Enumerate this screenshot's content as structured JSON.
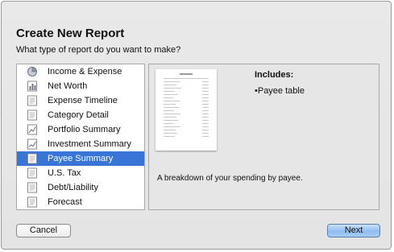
{
  "dialog": {
    "title": "Create New Report",
    "subtitle": "What type of report do you want to make?"
  },
  "report_types": [
    {
      "label": "Income & Expense",
      "icon": "pie-chart-icon"
    },
    {
      "label": "Net Worth",
      "icon": "bar-chart-icon"
    },
    {
      "label": "Expense Timeline",
      "icon": "report-page-icon"
    },
    {
      "label": "Category Detail",
      "icon": "report-page-icon"
    },
    {
      "label": "Portfolio Summary",
      "icon": "line-chart-icon"
    },
    {
      "label": "Investment Summary",
      "icon": "line-chart-icon"
    },
    {
      "label": "Payee Summary",
      "icon": "report-page-icon",
      "selected": true
    },
    {
      "label": "U.S. Tax",
      "icon": "report-page-icon"
    },
    {
      "label": "Debt/Liability",
      "icon": "report-page-icon"
    },
    {
      "label": "Forecast",
      "icon": "report-page-icon"
    }
  ],
  "preview": {
    "includes_heading": "Includes:",
    "includes_items": [
      "•Payee table"
    ],
    "description": "A breakdown of your spending by payee."
  },
  "buttons": {
    "cancel": "Cancel",
    "next": "Next"
  },
  "colors": {
    "selection": "#3875d7",
    "default_button": "#8fbdf0"
  }
}
